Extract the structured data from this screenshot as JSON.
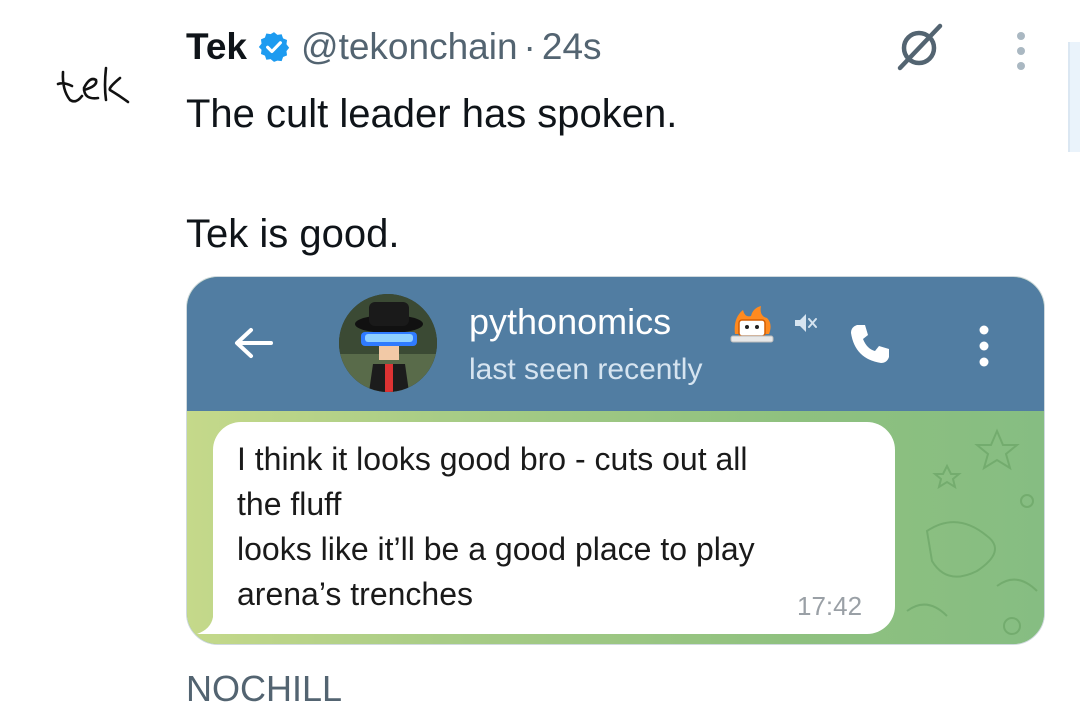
{
  "tweet": {
    "avatar_text": "tek",
    "display_name": "Tek",
    "handle": "@tekonchain",
    "separator": "·",
    "time": "24s",
    "text_line1": "The cult leader has spoken.",
    "text_line2": "Tek is good.",
    "caption": "NOCHILL"
  },
  "telegram": {
    "contact_name": "pythonomics",
    "status": "last seen recently",
    "message_lines": [
      "I think it looks good bro - cuts out all",
      "the fluff",
      "looks like it’ll be a good place to play",
      "arena’s trenches"
    ],
    "message_time": "17:42",
    "header_color": "#517da2"
  },
  "icons": {
    "verified": "verified-badge-icon",
    "grok": "grok-icon",
    "more": "more-vertical-icon",
    "back": "back-arrow-icon",
    "mute": "muted-icon",
    "call": "phone-icon",
    "menu": "kebab-menu-icon"
  },
  "colors": {
    "verified_blue": "#1d9bf0",
    "muted_gray": "#536471"
  }
}
